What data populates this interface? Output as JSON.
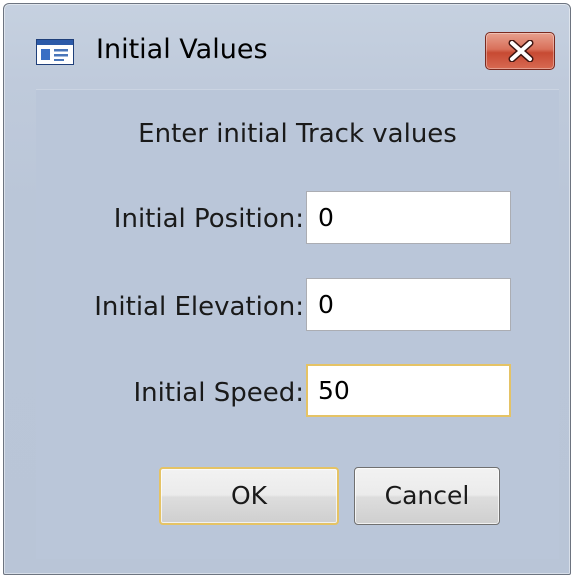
{
  "window": {
    "title": "Initial Values",
    "close_label": "Close"
  },
  "dialog": {
    "header": "Enter initial Track values",
    "fields": [
      {
        "label": "Initial Position:",
        "value": "0"
      },
      {
        "label": "Initial Elevation:",
        "value": "0"
      },
      {
        "label": "Initial Speed:",
        "value": "50",
        "focused": true
      }
    ],
    "ok_label": "OK",
    "cancel_label": "Cancel"
  },
  "colors": {
    "window_background": "#bac6d9",
    "focus_border": "#e5c365",
    "close_button": "#c74a33"
  },
  "icons": {
    "title": "window-app-icon",
    "close": "close-x-icon"
  }
}
